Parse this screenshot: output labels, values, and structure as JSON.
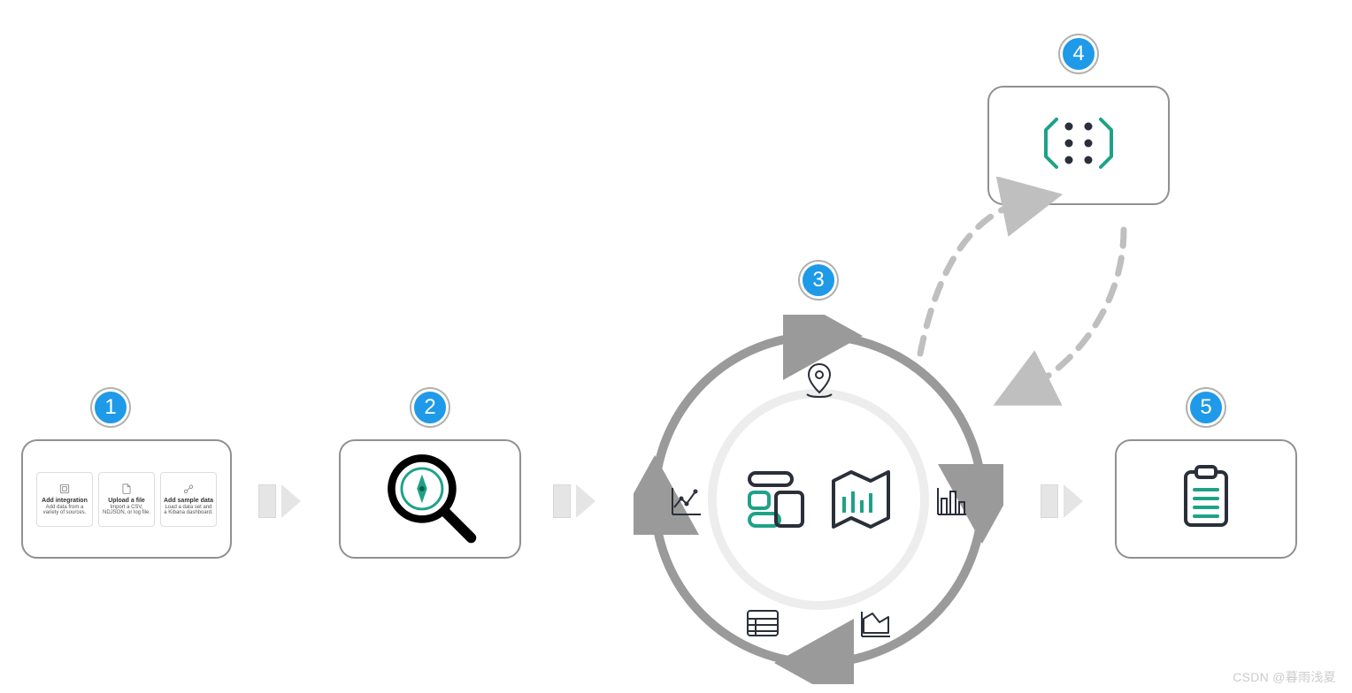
{
  "watermark": "CSDN @暮雨浅夏",
  "steps": {
    "s1": {
      "num": "1"
    },
    "s2": {
      "num": "2"
    },
    "s3": {
      "num": "3"
    },
    "s4": {
      "num": "4"
    },
    "s5": {
      "num": "5"
    }
  },
  "step1_cards": [
    {
      "title": "Add integration",
      "desc": "Add data from a variety of sources."
    },
    {
      "title": "Upload a file",
      "desc": "Import a CSV, NDJSON, or log file."
    },
    {
      "title": "Add sample data",
      "desc": "Load a data set and a Kibana dashboard."
    }
  ],
  "icons": {
    "step2": "compass-magnifier",
    "ring": [
      "location-pin",
      "line-chart",
      "table",
      "area-chart",
      "bar-chart"
    ],
    "center": [
      "dashboard",
      "map-chart"
    ],
    "step4": "ml-brackets-dots",
    "step5": "clipboard-list"
  },
  "colors": {
    "badge": "#1E9AE8",
    "accent": "#1EA287",
    "grey": "#909090",
    "arrow_light": "#BFBFBF"
  }
}
